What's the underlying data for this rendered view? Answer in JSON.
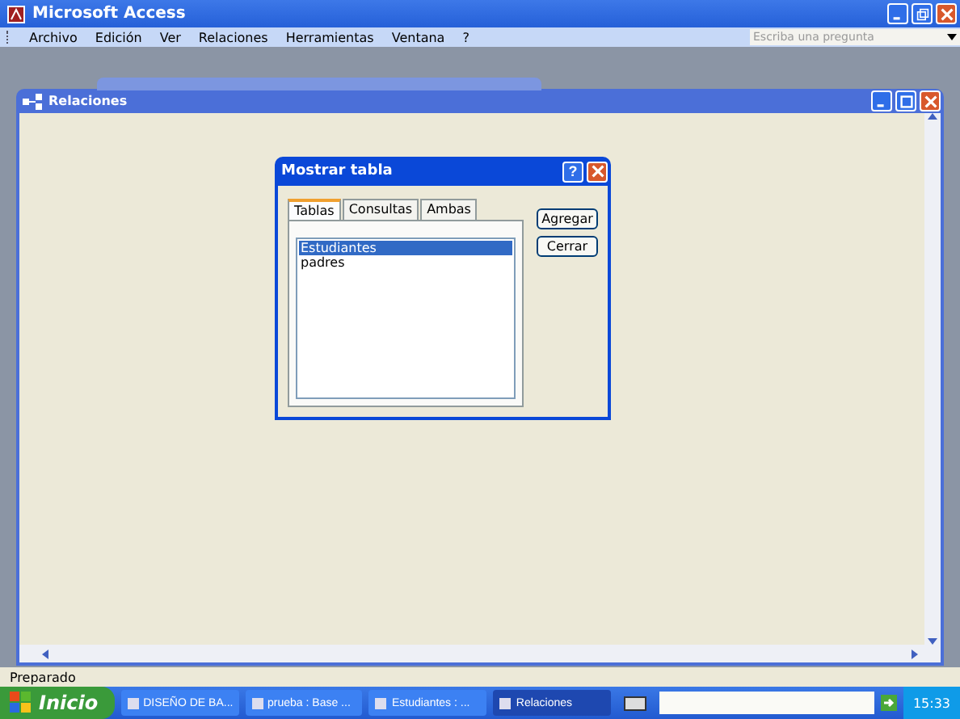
{
  "window": {
    "title": "Microsoft Access"
  },
  "menu": [
    "Archivo",
    "Edición",
    "Ver",
    "Relaciones",
    "Herramientas",
    "Ventana",
    "?"
  ],
  "help_field": {
    "placeholder": "Escriba una pregunta"
  },
  "child_window": {
    "title": "Relaciones"
  },
  "dialog": {
    "title": "Mostrar tabla",
    "help_button": "?",
    "tabs": [
      {
        "label": "Tablas",
        "selected": true
      },
      {
        "label": "Consultas",
        "selected": false
      },
      {
        "label": "Ambas",
        "selected": false
      }
    ],
    "items": [
      {
        "label": "Estudiantes",
        "selected": true
      },
      {
        "label": "padres",
        "selected": false
      }
    ],
    "buttons": [
      "Agregar",
      "Cerrar"
    ]
  },
  "status_bar": "Preparado",
  "taskbar": {
    "start": "Inicio",
    "tasks": [
      {
        "label": "DISEÑO DE BA...",
        "selected": false
      },
      {
        "label": "prueba : Base ...",
        "selected": false
      },
      {
        "label": "Estudiantes : ...",
        "selected": false
      },
      {
        "label": "Relaciones",
        "selected": true
      }
    ],
    "clock": "15:33"
  }
}
